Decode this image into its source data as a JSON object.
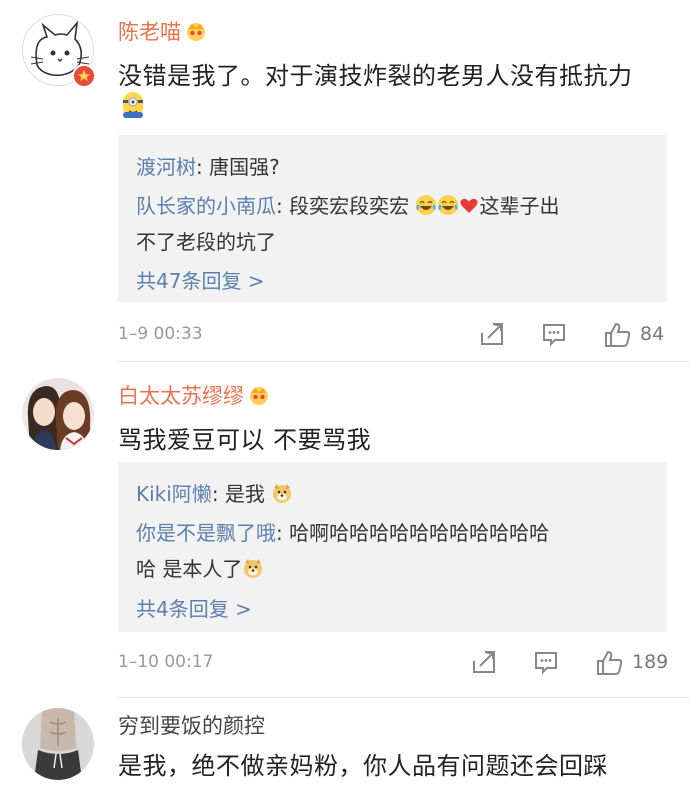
{
  "comments": [
    {
      "name": "陈老喵",
      "text": "没错是我了。对于演技炸裂的老男人没有抵抗力",
      "replies": [
        {
          "who": "渡河树",
          "sep": ": ",
          "text": "唐国强?"
        },
        {
          "who": "队长家的小南瓜",
          "sep": ": ",
          "text": "段奕宏段奕宏",
          "text_after": "这辈子出",
          "text_line2": "不了老段的坑了"
        }
      ],
      "more": "共47条回复 >",
      "time": "1–9 00:33",
      "likes": "84"
    },
    {
      "name": "白太太苏缪缪",
      "text": "骂我爱豆可以 不要骂我",
      "replies": [
        {
          "who": "Kiki阿懒",
          "sep": ": ",
          "text": "是我"
        },
        {
          "who": "你是不是飘了哦",
          "sep": ": ",
          "text": "哈啊哈哈哈哈哈哈哈哈哈哈哈",
          "text_line2": "哈 是本人了"
        }
      ],
      "more": "共4条回复 >",
      "time": "1–10 00:17",
      "likes": "189"
    },
    {
      "name": "穷到要饭的颜控",
      "text": "是我，绝不做亲妈粉，你人品有问题还会回踩"
    }
  ],
  "icons": {
    "share": "share-icon",
    "comment": "comment-icon",
    "like": "thumbs-up-icon",
    "crown": "crown-badge-icon"
  },
  "colors": {
    "name_highlight": "#eb7350",
    "reply_user": "#5b7fae",
    "reply_bg": "#f2f2f2",
    "meta": "#999999"
  }
}
